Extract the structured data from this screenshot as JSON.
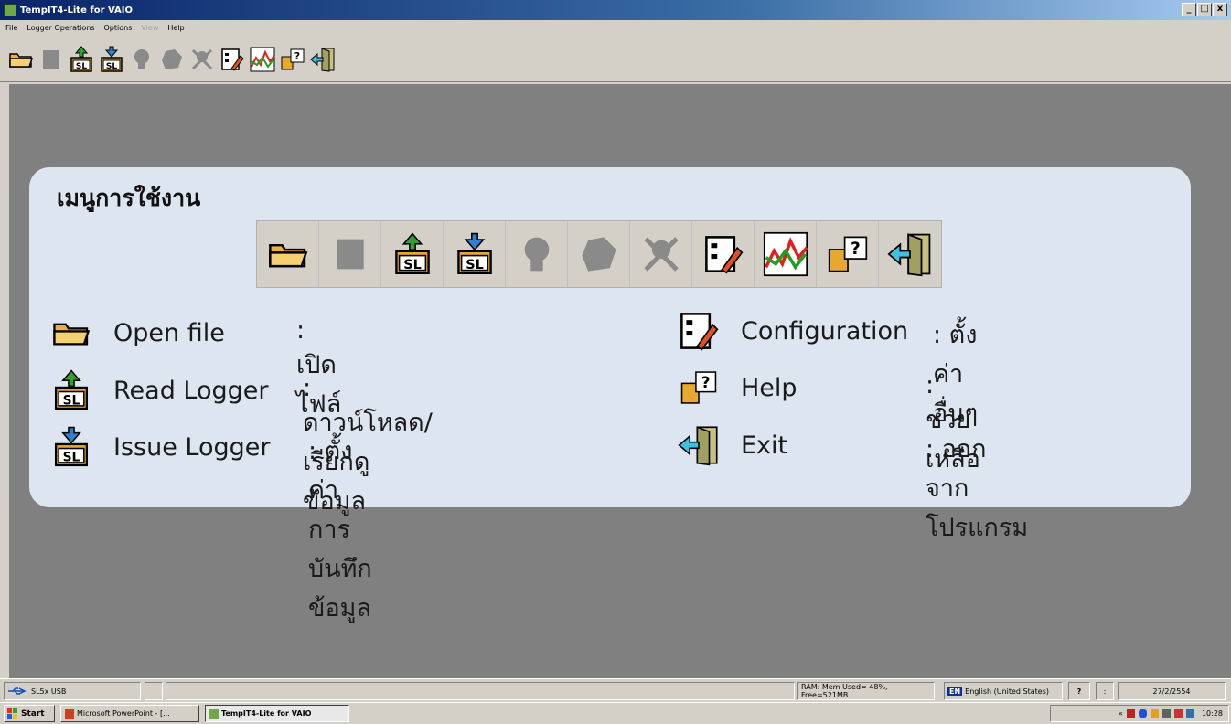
{
  "window": {
    "title": "TempIT4-Lite for VAIO",
    "controls": [
      "_",
      "□",
      "x"
    ]
  },
  "menubar": {
    "items": [
      {
        "label": "File",
        "enabled": true
      },
      {
        "label": "Logger Operations",
        "enabled": true
      },
      {
        "label": "Options",
        "enabled": true
      },
      {
        "label": "View",
        "enabled": false
      },
      {
        "label": "Help",
        "enabled": true
      }
    ]
  },
  "toolbar": {
    "buttons": [
      {
        "icon": "open-folder-icon",
        "enabled": true
      },
      {
        "icon": "stop-icon",
        "enabled": false
      },
      {
        "icon": "read-logger-icon",
        "enabled": true
      },
      {
        "icon": "issue-logger-icon",
        "enabled": true
      },
      {
        "icon": "head-icon",
        "enabled": false
      },
      {
        "icon": "map-icon",
        "enabled": false
      },
      {
        "icon": "tool-icon",
        "enabled": false
      },
      {
        "icon": "configuration-icon",
        "enabled": true
      },
      {
        "icon": "graph-icon",
        "enabled": true
      },
      {
        "icon": "help-icon",
        "enabled": true
      },
      {
        "icon": "exit-icon",
        "enabled": true
      }
    ]
  },
  "panel": {
    "title": "เมนูการใช้งาน",
    "left_items": [
      {
        "icon": "open-folder-icon",
        "label": "Open file",
        "desc": ": เปิดไฟล์"
      },
      {
        "icon": "read-logger-icon",
        "label": "Read Logger",
        "desc": ": ดาวน์โหลด/เรียกดูข้อมูล"
      },
      {
        "icon": "issue-logger-icon",
        "label": "Issue Logger",
        "desc": ": ตั้งค่าการบันทึกข้อมูล"
      }
    ],
    "right_items": [
      {
        "icon": "configuration-icon",
        "label": "Configuration",
        "desc": ": ตั้งค่าอื่นๆ"
      },
      {
        "icon": "help-icon",
        "label": "Help",
        "desc": ": ช่วยเหลือ"
      },
      {
        "icon": "exit-icon",
        "label": "Exit",
        "desc": ": ออกจากโปรแกรม"
      }
    ]
  },
  "statusbar": {
    "usb": "SL5x USB",
    "ram": "RAM: Mem Used= 48%, Free=521MB",
    "lang_code": "EN",
    "lang": "English (United States)",
    "date": "27/2/2554"
  },
  "taskbar": {
    "start": "Start",
    "tasks": [
      "Microsoft PowerPoint - [...",
      "TempIT4-Lite for VAIO"
    ],
    "time": "10:28"
  }
}
